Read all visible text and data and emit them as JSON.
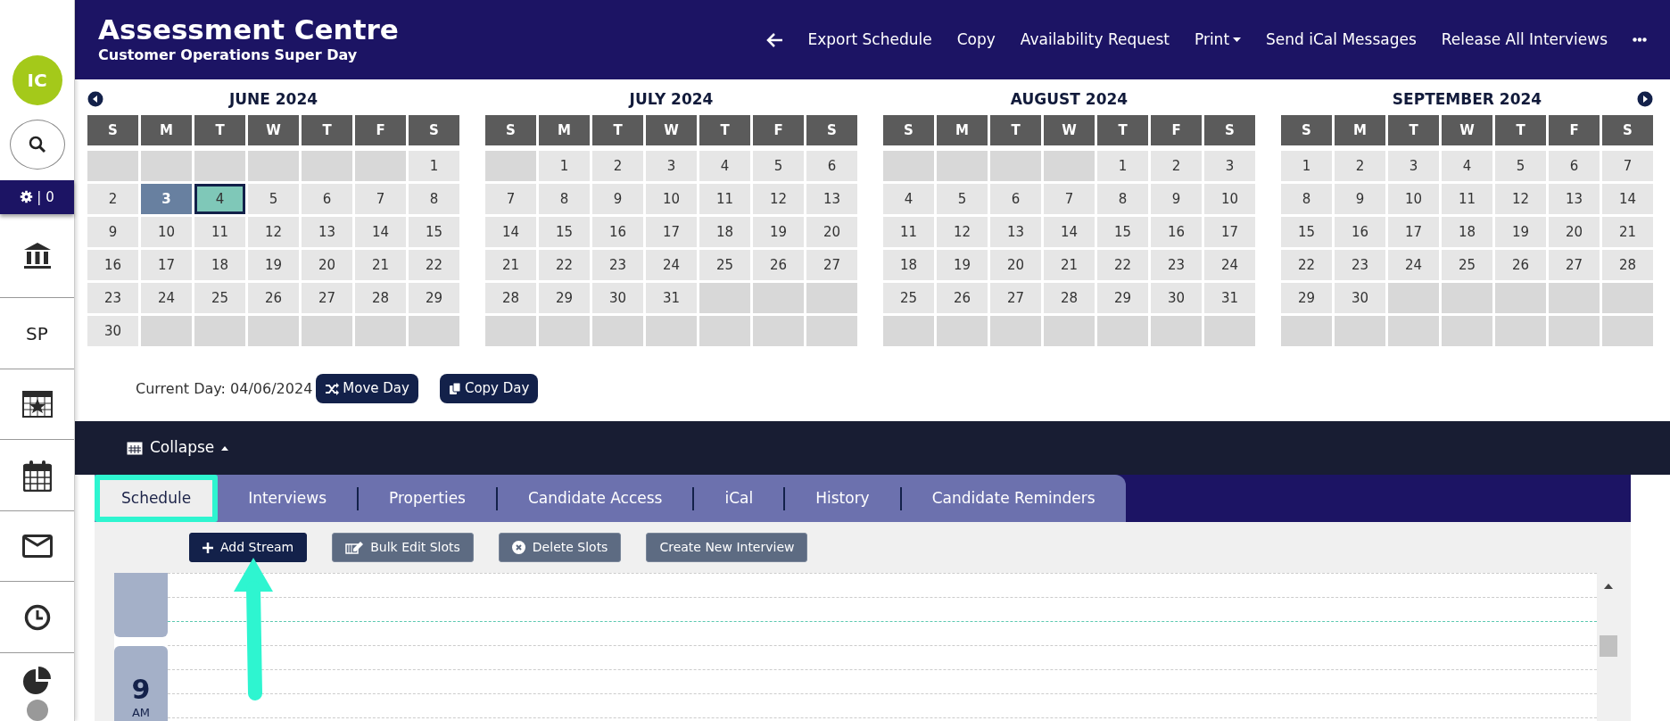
{
  "sidebar": {
    "avatar": "IC",
    "settings_label": "| 0",
    "initials_item": "SP"
  },
  "header": {
    "title": "Assessment Centre",
    "subtitle": "Customer Operations Super Day",
    "actions": [
      {
        "label": "Export Schedule",
        "dropdown": false
      },
      {
        "label": "Copy",
        "dropdown": false
      },
      {
        "label": "Availability Request",
        "dropdown": false
      },
      {
        "label": "Print",
        "dropdown": true
      },
      {
        "label": "Send iCal Messages",
        "dropdown": false
      },
      {
        "label": "Release All Interviews",
        "dropdown": false
      }
    ]
  },
  "calendar": {
    "months": [
      {
        "title": "JUNE 2024",
        "weekdays": [
          "S",
          "M",
          "T",
          "W",
          "T",
          "F",
          "S"
        ],
        "weeks": [
          {
            "kind": "lead",
            "days": [
              "1"
            ]
          },
          {
            "kind": "full",
            "days": [
              "2",
              {
                "day": "3",
                "kind": "today"
              },
              {
                "day": "4",
                "kind": "selected"
              },
              "5",
              "6",
              "7",
              "8"
            ]
          },
          {
            "kind": "full",
            "days": [
              "9",
              "10",
              "11",
              "12",
              "13",
              "14",
              "15"
            ]
          },
          {
            "kind": "full",
            "days": [
              "16",
              "17",
              "18",
              "19",
              "20",
              "21",
              "22"
            ]
          },
          {
            "kind": "full",
            "days": [
              "23",
              "24",
              "25",
              "26",
              "27",
              "28",
              "29"
            ]
          },
          {
            "kind": "trail",
            "days": [
              "30"
            ]
          }
        ]
      },
      {
        "title": "JULY 2024",
        "weekdays": [
          "S",
          "M",
          "T",
          "W",
          "T",
          "F",
          "S"
        ],
        "weeks": [
          {
            "kind": "lead",
            "days": [
              "1",
              "2",
              "3",
              "4",
              "5",
              "6"
            ]
          },
          {
            "kind": "full",
            "days": [
              "7",
              "8",
              "9",
              "10",
              "11",
              "12",
              "13"
            ]
          },
          {
            "kind": "full",
            "days": [
              "14",
              "15",
              "16",
              "17",
              "18",
              "19",
              "20"
            ]
          },
          {
            "kind": "full",
            "days": [
              "21",
              "22",
              "23",
              "24",
              "25",
              "26",
              "27"
            ]
          },
          {
            "kind": "trail",
            "days": [
              "28",
              "29",
              "30",
              "31"
            ]
          },
          {
            "kind": "blank"
          }
        ]
      },
      {
        "title": "AUGUST 2024",
        "weekdays": [
          "S",
          "M",
          "T",
          "W",
          "T",
          "F",
          "S"
        ],
        "weeks": [
          {
            "kind": "lead",
            "days": [
              "1",
              "2",
              "3"
            ]
          },
          {
            "kind": "full",
            "days": [
              "4",
              "5",
              "6",
              "7",
              "8",
              "9",
              "10"
            ]
          },
          {
            "kind": "full",
            "days": [
              "11",
              "12",
              "13",
              "14",
              "15",
              "16",
              "17"
            ]
          },
          {
            "kind": "full",
            "days": [
              "18",
              "19",
              "20",
              "21",
              "22",
              "23",
              "24"
            ]
          },
          {
            "kind": "full",
            "days": [
              "25",
              "26",
              "27",
              "28",
              "29",
              "30",
              "31"
            ]
          },
          {
            "kind": "blank"
          }
        ]
      },
      {
        "title": "SEPTEMBER 2024",
        "weekdays": [
          "S",
          "M",
          "T",
          "W",
          "T",
          "F",
          "S"
        ],
        "weeks": [
          {
            "kind": "full",
            "days": [
              "1",
              "2",
              "3",
              "4",
              "5",
              "6",
              "7"
            ]
          },
          {
            "kind": "full",
            "days": [
              "8",
              "9",
              "10",
              "11",
              "12",
              "13",
              "14"
            ]
          },
          {
            "kind": "full",
            "days": [
              "15",
              "16",
              "17",
              "18",
              "19",
              "20",
              "21"
            ]
          },
          {
            "kind": "full",
            "days": [
              "22",
              "23",
              "24",
              "25",
              "26",
              "27",
              "28"
            ]
          },
          {
            "kind": "trail",
            "days": [
              "29",
              "30"
            ]
          },
          {
            "kind": "blank"
          }
        ]
      }
    ]
  },
  "current_day": {
    "label": "Current Day: 04/06/2024",
    "buttons": [
      {
        "label": "Move Day",
        "kind": "move"
      },
      {
        "label": "Copy Day",
        "kind": "copy"
      }
    ]
  },
  "collapse": {
    "label": "Collapse"
  },
  "tabs": [
    {
      "label": "Schedule",
      "selected": true
    },
    {
      "label": "Interviews",
      "selected": false
    },
    {
      "label": "Properties",
      "selected": false
    },
    {
      "label": "Candidate Access",
      "selected": false
    },
    {
      "label": "iCal",
      "selected": false
    },
    {
      "label": "History",
      "selected": false
    },
    {
      "label": "Candidate Reminders",
      "selected": false
    }
  ],
  "toolbar": [
    {
      "label": "Add Stream",
      "kind": "add"
    },
    {
      "label": "Bulk Edit Slots",
      "kind": "edit"
    },
    {
      "label": "Delete Slots",
      "kind": "delete"
    },
    {
      "label": "Create New Interview",
      "kind": "plain"
    }
  ],
  "schedule": {
    "hour": "9",
    "period": "AM"
  }
}
